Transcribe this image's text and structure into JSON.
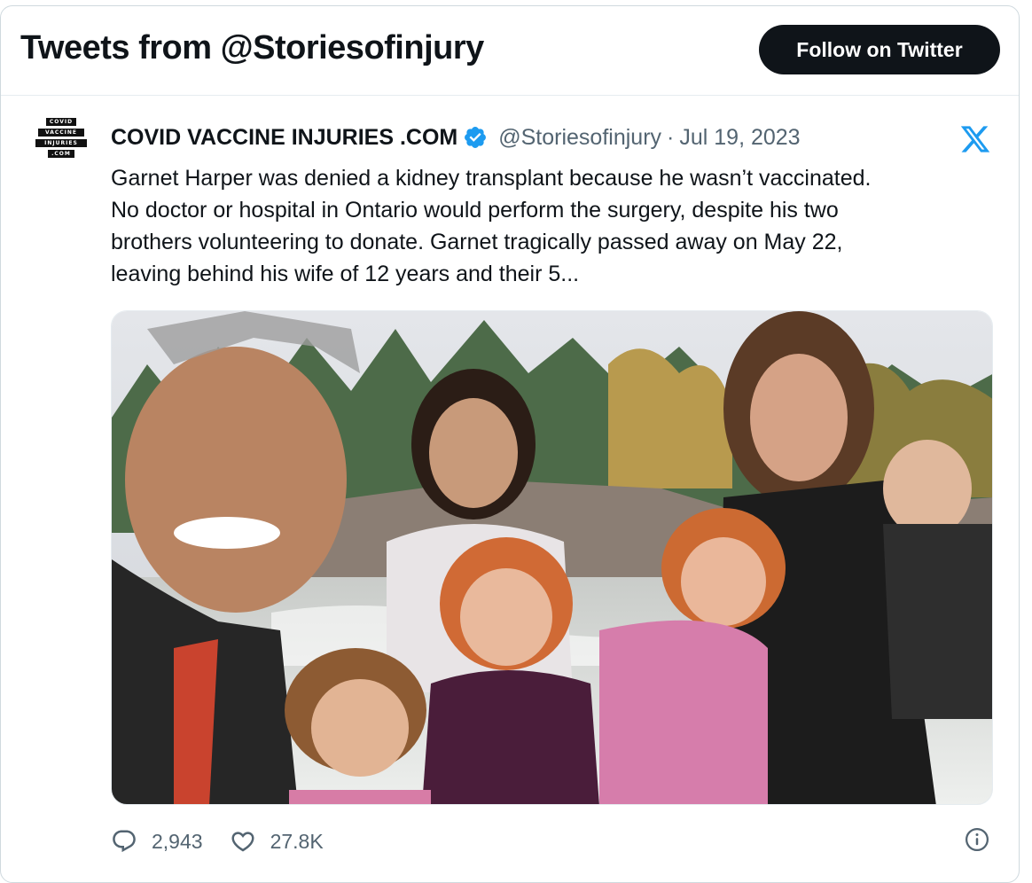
{
  "header": {
    "title": "Tweets from @Storiesofinjury",
    "follow_label": "Follow on Twitter"
  },
  "tweet": {
    "avatar_lines": [
      "COVID",
      "VACCINE",
      "INJURIES",
      ".COM"
    ],
    "author_name": "COVID VACCINE INJURIES .COM",
    "verified_icon": "verified-badge-icon",
    "handle": "@Storiesofinjury",
    "separator": "·",
    "date": "Jul 19, 2023",
    "platform_icon": "x-logo-icon",
    "text_lines": [
      "Garnet Harper was denied a kidney transplant because he wasn’t vaccinated.",
      "No doctor or hospital in Ontario would perform the surgery, despite his two",
      "brothers volunteering to donate.  Garnet tragically passed away on May 22,",
      "leaving behind his wife of 12 years and their 5..."
    ],
    "media": {
      "type": "photo",
      "subject": "family photo"
    },
    "reply_count": "2,943",
    "like_count": "27.8K",
    "reply_icon": "reply-icon",
    "like_icon": "heart-icon",
    "info_icon": "info-icon"
  },
  "colors": {
    "primary_text": "#0f1419",
    "secondary_text": "#536471",
    "verified_blue": "#1d9bf0",
    "x_logo_blue": "#1d9bf0",
    "button_bg": "#0f1419",
    "border": "#cfd9de"
  }
}
